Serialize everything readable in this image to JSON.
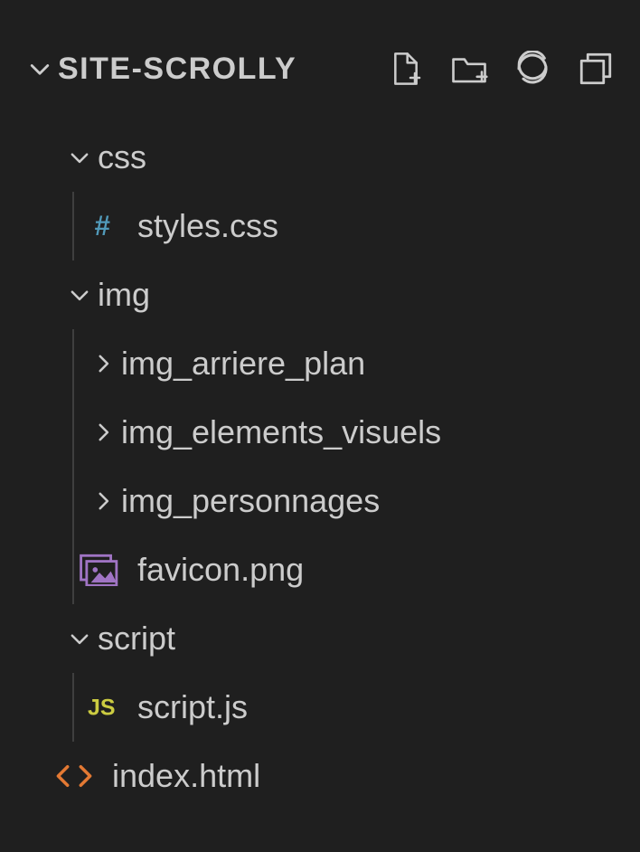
{
  "header": {
    "title": "SITE-SCROLLY"
  },
  "actions": {
    "newFile": "new-file",
    "newFolder": "new-folder",
    "refresh": "refresh",
    "collapse": "collapse-all"
  },
  "tree": {
    "css": {
      "label": "css",
      "styles": {
        "label": "styles.css"
      }
    },
    "img": {
      "label": "img",
      "arriere": {
        "label": "img_arriere_plan"
      },
      "elements": {
        "label": "img_elements_visuels"
      },
      "personnages": {
        "label": "img_personnages"
      },
      "favicon": {
        "label": "favicon.png"
      }
    },
    "script": {
      "label": "script",
      "scriptjs": {
        "label": "script.js"
      }
    },
    "index": {
      "label": "index.html"
    }
  }
}
